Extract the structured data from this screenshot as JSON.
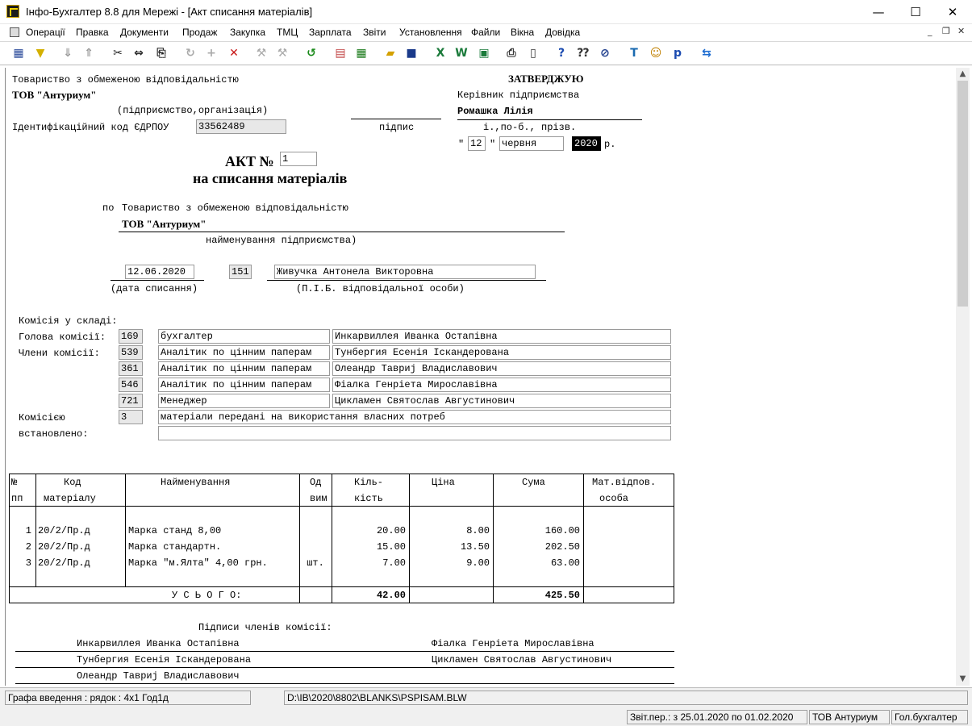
{
  "window": {
    "title": "Інфо-Бухгалтер 8.8 для Мережі - [Акт списання матеріалів]",
    "minimize": "—",
    "maximize": "☐",
    "close": "✕"
  },
  "menu": [
    "Операції",
    "Правка",
    "Документи",
    "Продаж",
    "Закупка",
    "ТМЦ",
    "Зарплата",
    "Звіти",
    "Установлення",
    "Файли",
    "Вікна",
    "Довідка"
  ],
  "mdi": {
    "minimize": "_",
    "restore": "❐",
    "close": "✕"
  },
  "toolbar": [
    {
      "icon": "table-icon",
      "g": "▦",
      "c": "#2a4a9a"
    },
    {
      "icon": "filter-icon",
      "g": "▼",
      "c": "#d4b000"
    },
    {
      "icon": "sort-desc-icon",
      "g": "⇓",
      "c": "#999"
    },
    {
      "icon": "sort-asc-icon",
      "g": "⇑",
      "c": "#999"
    },
    {
      "icon": "cut-icon",
      "g": "✂",
      "c": "#222"
    },
    {
      "icon": "split-icon",
      "g": "⇔",
      "c": "#222"
    },
    {
      "icon": "copy-icon",
      "g": "⎘",
      "c": "#222"
    },
    {
      "icon": "rotate-icon",
      "g": "↻",
      "c": "#aaa"
    },
    {
      "icon": "add-icon",
      "g": "+",
      "c": "#aaa"
    },
    {
      "icon": "delete-icon",
      "g": "✕",
      "c": "#c81818"
    },
    {
      "icon": "stamp-icon",
      "g": "⚒",
      "c": "#aaa"
    },
    {
      "icon": "stamp2-icon",
      "g": "⚒",
      "c": "#aaa"
    },
    {
      "icon": "refresh-icon",
      "g": "↺",
      "c": "#1a8a1a"
    },
    {
      "icon": "report-icon",
      "g": "▤",
      "c": "#c04040"
    },
    {
      "icon": "calculator-icon",
      "g": "▦",
      "c": "#1a7a1a"
    },
    {
      "icon": "open-folder-icon",
      "g": "▰",
      "c": "#d4a000"
    },
    {
      "icon": "save-icon",
      "g": "■",
      "c": "#1a3a8a"
    },
    {
      "icon": "excel-icon",
      "g": "X",
      "c": "#1a7a3a"
    },
    {
      "icon": "word-icon",
      "g": "W",
      "c": "#1a7a3a"
    },
    {
      "icon": "export-icon",
      "g": "▣",
      "c": "#1a7a3a"
    },
    {
      "icon": "print-icon",
      "g": "⎙",
      "c": "#333"
    },
    {
      "icon": "preview-icon",
      "g": "▯",
      "c": "#333"
    },
    {
      "icon": "help-icon",
      "g": "?",
      "c": "#1a4ab0"
    },
    {
      "icon": "context-help-icon",
      "g": "⁇",
      "c": "#333"
    },
    {
      "icon": "compass-icon",
      "g": "⊘",
      "c": "#1a3a8a"
    },
    {
      "icon": "text-icon",
      "g": "T",
      "c": "#1a6ab0"
    },
    {
      "icon": "users-icon",
      "g": "☺",
      "c": "#c08000"
    },
    {
      "icon": "doc-p-icon",
      "g": "p",
      "c": "#1a4ab0"
    },
    {
      "icon": "teamviewer-icon",
      "g": "⇆",
      "c": "#1a6ad0"
    }
  ],
  "header": {
    "org_full": "Товариство з обмеженою відповідальністю",
    "org_short": "ТОВ \"Антуриум\"",
    "org_caption": "(підприємство,організація)",
    "edrpou_label": "Ідентифікаційний код ЄДРПОУ",
    "edrpou": "33562489",
    "approve": "ЗАТВЕРДЖУЮ",
    "head_title": "Керівник підприємства",
    "head_name": "Ромашка Лілія",
    "sign_caption": "підпис",
    "name_caption": "і.,по-б., прізв.",
    "q_open": "\"",
    "day": "12",
    "q_close": "\"",
    "month": "червня",
    "year": "2020",
    "year_suffix": "р."
  },
  "act": {
    "title": "АКТ №",
    "number": "1",
    "subtitle": "на списання матеріалів",
    "po": "по",
    "org_full": "Товариство з обмеженою відповідальністю",
    "org_short": "ТОВ \"Антуриум\"",
    "org_caption": "найменування підприємства)",
    "date": "12.06.2020",
    "date_caption": "(дата списання)",
    "person_code": "151",
    "person_name": "Живучка Антонела Викторовна",
    "person_caption": "(П.І.Б. відповідальної особи)"
  },
  "commission": {
    "header": "Комісія у складі:",
    "head_label": "Голова комісії:",
    "members_label": "Члени комісії:",
    "rows": [
      {
        "code": "169",
        "position": "бухгалтер",
        "name": "Инкарвиллея Иванка Остапівна"
      },
      {
        "code": "539",
        "position": "Аналітик по цінним паперам",
        "name": "Тунбергия Есенія Іскандерована"
      },
      {
        "code": "361",
        "position": "Аналітик по цінним паперам",
        "name": "Олеандр Тавриј Владиславович"
      },
      {
        "code": "546",
        "position": "Аналітик по цінним паперам",
        "name": "Фіалка Генріета Мирославівна"
      },
      {
        "code": "721",
        "position": "Менеджер",
        "name": "Цикламен Святослав Августинович"
      }
    ],
    "established_label1": "Комісією",
    "established_label2": "встановлено:",
    "established_code": "3",
    "established_text1": "матеріали передані на використання власних потреб",
    "established_text2": ""
  },
  "table": {
    "headers": {
      "no1": "№",
      "no2": "пп",
      "code1": "Код",
      "code2": "матеріалу",
      "name": "Найменування",
      "unit1": "Од",
      "unit2": "вим",
      "qty1": "Кіль-",
      "qty2": "кість",
      "price": "Ціна",
      "sum": "Сума",
      "resp1": "Мат.відпов.",
      "resp2": "особа"
    },
    "rows": [
      {
        "no": "1",
        "code": "20/2/Пр.д",
        "name": "Марка станд 8,00",
        "unit": "",
        "qty": "20.00",
        "price": "8.00",
        "sum": "160.00"
      },
      {
        "no": "2",
        "code": "20/2/Пр.д",
        "name": "Марка стандартн.",
        "unit": "",
        "qty": "15.00",
        "price": "13.50",
        "sum": "202.50"
      },
      {
        "no": "3",
        "code": "20/2/Пр.д",
        "name": "Марка \"м.Ялта\" 4,00 грн.",
        "unit": "шт.",
        "qty": "7.00",
        "price": "9.00",
        "sum": "63.00"
      }
    ],
    "total_label": "У С Ь О Г О:",
    "total_qty": "42.00",
    "total_sum": "425.50"
  },
  "signatures": {
    "header": "Підписи членів комісії:",
    "names": [
      "Инкарвиллея Иванка Остапівна",
      "Фіалка Генріета Мирославівна",
      "Тунбергия Есенія Іскандерована",
      "Цикламен Святослав Августинович",
      "Олеандр Тавриј Владиславович"
    ]
  },
  "status": {
    "input": "Графа  введення : рядок : 4x1  Год1д",
    "path": "D:\\IB\\2020\\8802\\BLANKS\\PSPISAM.BLW",
    "period": "Звіт.пер.: з 25.01.2020 по 01.02.2020",
    "company": "ТОВ Антуриум",
    "role": "Гол.бухгалтер"
  }
}
